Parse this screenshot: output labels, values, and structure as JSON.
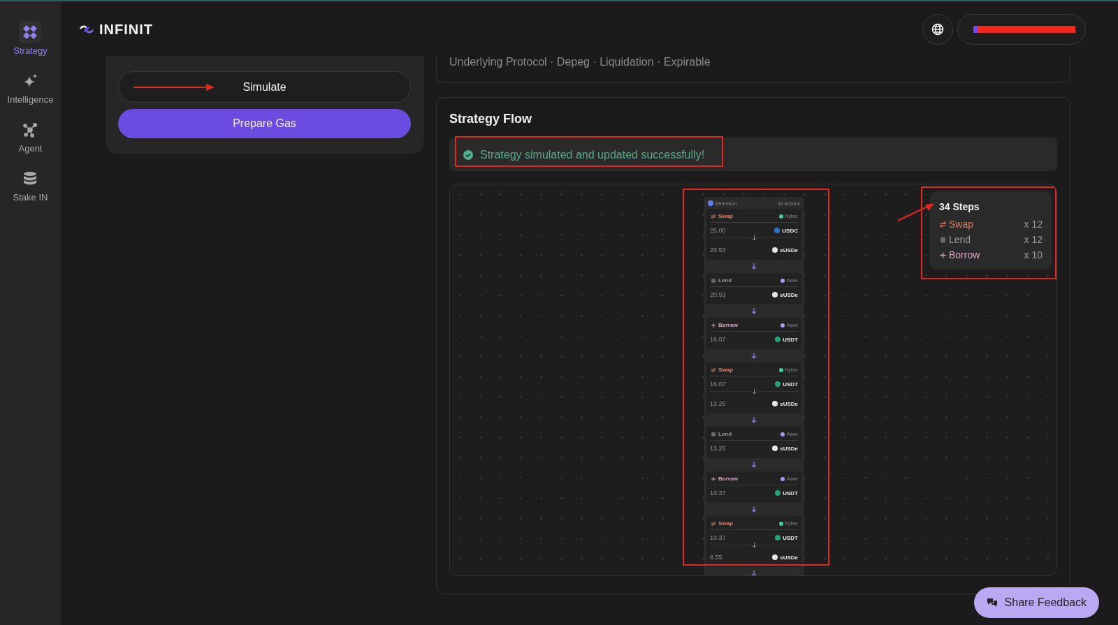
{
  "sidebar": {
    "items": [
      {
        "kind": "strategy",
        "label": "Strategy",
        "selected": true
      },
      {
        "kind": "intelligence",
        "label": "Intelligence",
        "selected": false
      },
      {
        "kind": "agent",
        "label": "Agent",
        "selected": false
      },
      {
        "kind": "stake",
        "label": "Stake IN",
        "selected": false
      }
    ]
  },
  "header": {
    "logo": "INFINIT"
  },
  "actions": {
    "simulate": "Simulate",
    "prepare": "Prepare Gas"
  },
  "risks": "Underlying Protocol · Depeg · Liquidation · Expirable",
  "flow": {
    "title": "Strategy Flow",
    "message": "Strategy simulated and updated successfully!",
    "chain": "Ethereum",
    "actions_count": "34 Actions",
    "steps": [
      {
        "kind": "swap",
        "label": "Swap",
        "protocol": {
          "name": "Kyber",
          "color": "#3ecf9a"
        },
        "rows": [
          {
            "amount": "25.00",
            "token": "USDC",
            "color": "#2775ca"
          },
          {
            "amount": "20.53",
            "token": "sUSDe",
            "color": "#e6e6e6"
          }
        ]
      },
      {
        "kind": "lend",
        "label": "Lend",
        "protocol": {
          "name": "Aave",
          "color": "#a49cf0"
        },
        "rows": [
          {
            "amount": "20.53",
            "token": "sUSDe",
            "color": "#e6e6e6"
          }
        ]
      },
      {
        "kind": "borrow",
        "label": "Borrow",
        "protocol": {
          "name": "Aave",
          "color": "#a49cf0"
        },
        "rows": [
          {
            "amount": "16.07",
            "token": "USDT",
            "color": "#26a17b"
          }
        ]
      },
      {
        "kind": "swap",
        "label": "Swap",
        "protocol": {
          "name": "Kyber",
          "color": "#3ecf9a"
        },
        "rows": [
          {
            "amount": "16.07",
            "token": "USDT",
            "color": "#26a17b"
          },
          {
            "amount": "13.25",
            "token": "sUSDe",
            "color": "#e6e6e6"
          }
        ]
      },
      {
        "kind": "lend",
        "label": "Lend",
        "protocol": {
          "name": "Aave",
          "color": "#a49cf0"
        },
        "rows": [
          {
            "amount": "13.25",
            "token": "sUSDe",
            "color": "#e6e6e6"
          }
        ]
      },
      {
        "kind": "borrow",
        "label": "Borrow",
        "protocol": {
          "name": "Aave",
          "color": "#a49cf0"
        },
        "rows": [
          {
            "amount": "10.37",
            "token": "USDT",
            "color": "#26a17b"
          }
        ]
      },
      {
        "kind": "swap",
        "label": "Swap",
        "protocol": {
          "name": "Kyber",
          "color": "#3ecf9a"
        },
        "rows": [
          {
            "amount": "10.37",
            "token": "USDT",
            "color": "#26a17b"
          },
          {
            "amount": "8.55",
            "token": "sUSDe",
            "color": "#e6e6e6"
          }
        ]
      }
    ],
    "summary": {
      "title": "34 Steps",
      "items": [
        {
          "kind": "swap",
          "label": "Swap",
          "count": "x 12"
        },
        {
          "kind": "lend",
          "label": "Lend",
          "count": "x 12"
        },
        {
          "kind": "borrow",
          "label": "Borrow",
          "count": "x 10"
        }
      ]
    }
  },
  "feedback": "Share Feedback"
}
